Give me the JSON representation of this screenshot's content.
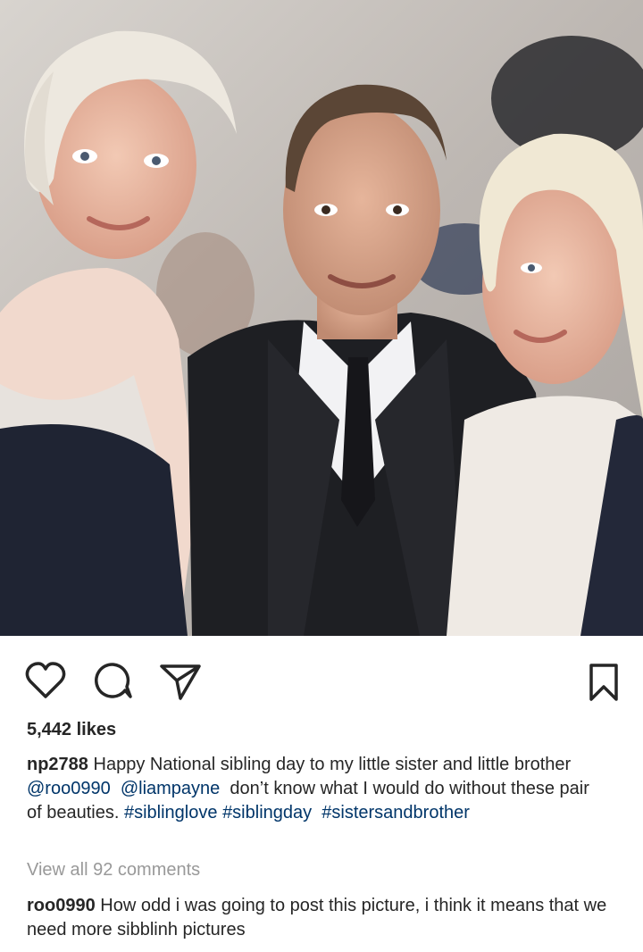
{
  "post": {
    "photo_icon": "post-photo",
    "likes_text": "5,442 likes",
    "caption": {
      "username": "np2788",
      "text_1": "Happy National sibling day to my little sister and little brother",
      "mention_1": "@roo0990",
      "mention_2": "@liampayne",
      "text_2": "don’t know what I would do without these pair of beauties.",
      "hashtag_1": "#siblinglove",
      "hashtag_2": "#siblingday",
      "hashtag_3": "#sistersandbrother"
    },
    "view_comments": "View all 92 comments",
    "comment": {
      "username": "roo0990",
      "text": "How odd i was going to post this picture, i think it means that we need more sibblinh pictures"
    }
  },
  "actions": {
    "like_icon": "heart-icon",
    "comment_icon": "comment-bubble-icon",
    "share_icon": "paper-plane-icon",
    "save_icon": "bookmark-icon"
  },
  "colors": {
    "text": "#262626",
    "link": "#003569",
    "muted": "#999999",
    "background": "#ffffff"
  }
}
